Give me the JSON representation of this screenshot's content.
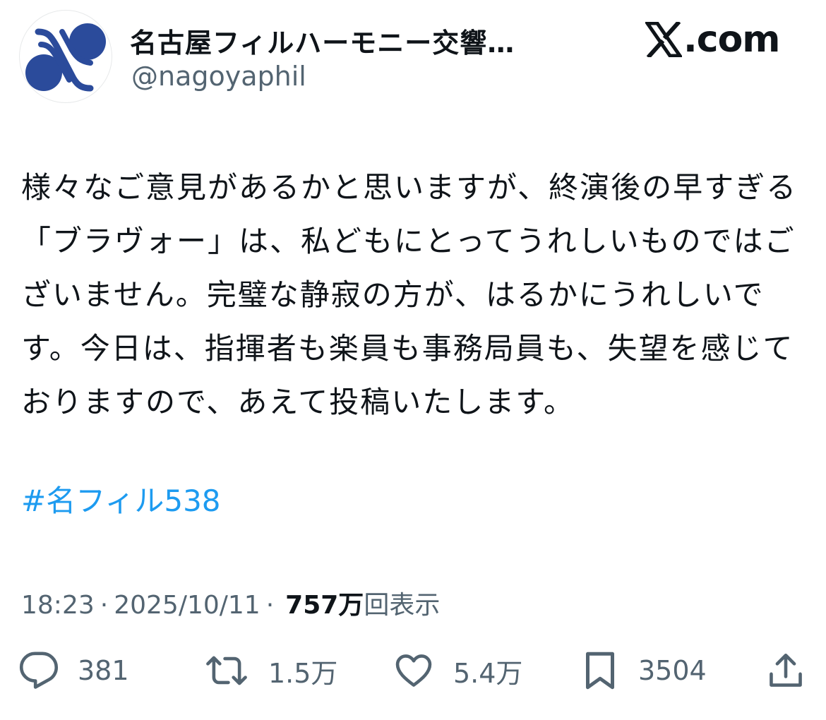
{
  "author": {
    "display_name": "名古屋フィルハーモニー交響…",
    "handle": "@nagoyaphil",
    "avatar_icon": "orchestra-logo-icon"
  },
  "brand": {
    "label": ".com",
    "icon": "x-logo-icon"
  },
  "tweet": {
    "text": "様々なご意見があるかと思いますが、終演後の早すぎる「ブラヴォー」は、私どもにとってうれしいものではございません。完璧な静寂の方が、はるかにうれしいです。今日は、指揮者も楽員も事務局員も、失望を感じておりますので、あえて投稿いたします。",
    "hashtag": "#名フィル538"
  },
  "meta": {
    "time": "18:23",
    "separator": "·",
    "date": "2025/10/11",
    "views_count": "757万",
    "views_label": "回表示"
  },
  "actions": {
    "reply": {
      "icon": "reply-icon",
      "count": "381"
    },
    "repost": {
      "icon": "repost-icon",
      "count": "1.5万"
    },
    "like": {
      "icon": "heart-icon",
      "count": "5.4万"
    },
    "bookmark": {
      "icon": "bookmark-icon",
      "count": "3504"
    },
    "share": {
      "icon": "share-icon"
    }
  },
  "colors": {
    "text": "#0f1419",
    "secondary": "#536471",
    "link": "#1d9bf0",
    "logo": "#2b4b9b"
  }
}
